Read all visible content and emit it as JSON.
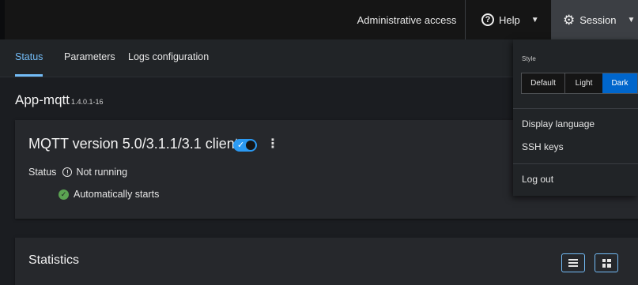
{
  "header": {
    "admin_access": "Administrative access",
    "help_label": "Help",
    "session_label": "Session",
    "icons": {
      "help": "help-circle-icon",
      "session": "gear-icon",
      "caret": "caret-down-icon"
    }
  },
  "tabs": [
    {
      "label": "Status",
      "active": true
    },
    {
      "label": "Parameters",
      "active": false
    },
    {
      "label": "Logs configuration",
      "active": false
    }
  ],
  "app": {
    "name": "App-mqtt",
    "version": "1.4.0.1-16"
  },
  "client_card": {
    "title": "MQTT version 5.0/3.1.1/3.1 client",
    "status_label": "Status",
    "status_value": "Not running",
    "autostart": "Automatically starts",
    "toggle_on": true
  },
  "statistics": {
    "title": "Statistics"
  },
  "session_menu": {
    "style_label": "Style",
    "styles": [
      "Default",
      "Light",
      "Dark"
    ],
    "selected_style": "Dark",
    "display_language": "Display language",
    "ssh_keys": "SSH keys",
    "log_out": "Log out"
  },
  "colors": {
    "accent": "#73bcf7",
    "primary": "#0066cc",
    "toggle": "#2b9af3",
    "success": "#5ba352",
    "background": "#1b1d21"
  }
}
